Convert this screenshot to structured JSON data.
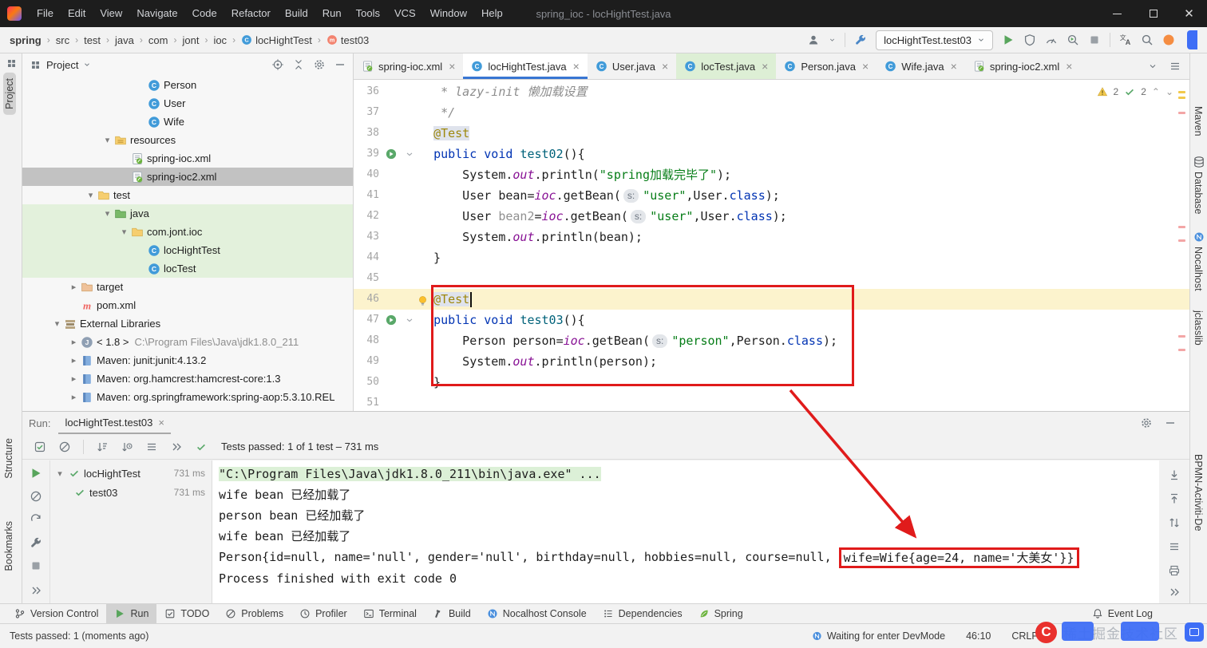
{
  "colors": {
    "accent_blue": "#3876d3",
    "annotation_red": "#e01b1b",
    "test_green": "#59a869",
    "selection_gray": "#c2c2c2",
    "test_row_green": "#e3f1dc",
    "current_line": "#fcf3cd"
  },
  "titlebar": {
    "menus": [
      "File",
      "Edit",
      "View",
      "Navigate",
      "Code",
      "Refactor",
      "Build",
      "Run",
      "Tools",
      "VCS",
      "Window",
      "Help"
    ],
    "title": "spring_ioc - locHightTest.java"
  },
  "navbar": {
    "crumbs": [
      {
        "label": "spring"
      },
      {
        "label": "src"
      },
      {
        "label": "test"
      },
      {
        "label": "java"
      },
      {
        "label": "com"
      },
      {
        "label": "jont"
      },
      {
        "label": "ioc"
      },
      {
        "label": "locHightTest",
        "icon": "cls"
      },
      {
        "label": "test03",
        "icon": "method"
      }
    ],
    "run_config": "locHightTest.test03"
  },
  "left_strip": {
    "items": [
      "Project",
      "Structure",
      "Bookmarks"
    ]
  },
  "right_strip": {
    "top": [
      "Maven",
      "Database",
      "Nocalhost",
      "jclasslib"
    ],
    "bottom": [
      "BPMN-Activiti-De"
    ]
  },
  "project": {
    "title": "Project",
    "rows": [
      {
        "label": "Person",
        "icon": "cls",
        "indent": 6
      },
      {
        "label": "User",
        "icon": "cls",
        "indent": 6
      },
      {
        "label": "Wife",
        "icon": "cls",
        "indent": 6
      },
      {
        "label": "resources",
        "icon": "folderres",
        "indent": 4,
        "chev": "v"
      },
      {
        "label": "spring-ioc.xml",
        "icon": "springxml",
        "indent": 5
      },
      {
        "label": "spring-ioc2.xml",
        "icon": "springxml",
        "indent": 5,
        "selected": true
      },
      {
        "label": "test",
        "icon": "folder",
        "indent": 3,
        "chev": "v"
      },
      {
        "label": "java",
        "icon": "foldertest",
        "indent": 4,
        "chev": "v",
        "green": true
      },
      {
        "label": "com.jont.ioc",
        "icon": "folder",
        "indent": 5,
        "chev": "v",
        "green": true
      },
      {
        "label": "locHightTest",
        "icon": "cls",
        "indent": 6,
        "green": true
      },
      {
        "label": "locTest",
        "icon": "cls",
        "indent": 6,
        "green": true
      },
      {
        "label": "target",
        "icon": "folderexcl",
        "indent": 2,
        "chev": ">"
      },
      {
        "label": "pom.xml",
        "icon": "maven",
        "indent": 2
      },
      {
        "label": "External Libraries",
        "icon": "libs",
        "indent": 1,
        "chev": "v"
      },
      {
        "label": "< 1.8 >",
        "sub": "C:\\Program Files\\Java\\jdk1.8.0_211",
        "icon": "jdk",
        "indent": 2,
        "chev": ">"
      },
      {
        "label": "Maven: junit:junit:4.13.2",
        "icon": "lib",
        "indent": 2,
        "chev": ">"
      },
      {
        "label": "Maven: org.hamcrest:hamcrest-core:1.3",
        "icon": "lib",
        "indent": 2,
        "chev": ">"
      },
      {
        "label": "Maven: org.springframework:spring-aop:5.3.10.REL",
        "icon": "lib",
        "indent": 2,
        "chev": ">"
      }
    ]
  },
  "editor_tabs": {
    "tabs": [
      {
        "label": "spring-ioc.xml",
        "icon": "springxml"
      },
      {
        "label": "locHightTest.java",
        "icon": "cls",
        "active": true
      },
      {
        "label": "User.java",
        "icon": "cls"
      },
      {
        "label": "locTest.java",
        "icon": "cls",
        "green": true
      },
      {
        "label": "Person.java",
        "icon": "cls"
      },
      {
        "label": "Wife.java",
        "icon": "cls"
      },
      {
        "label": "spring-ioc2.xml",
        "icon": "springxml"
      }
    ]
  },
  "inspections": {
    "warnings": "2",
    "checks": "2"
  },
  "editor": {
    "lines": [
      {
        "n": "36",
        "segs": [
          [
            "cmt",
            "   * lazy-init 懒加载设置"
          ]
        ]
      },
      {
        "n": "37",
        "segs": [
          [
            "cmt",
            "   */"
          ]
        ]
      },
      {
        "n": "38",
        "segs": [
          [
            "pln",
            "  "
          ],
          [
            "annhl",
            "@Test"
          ]
        ]
      },
      {
        "n": "39",
        "run": true,
        "fold": true,
        "segs": [
          [
            "pln",
            "  "
          ],
          [
            "kw",
            "public"
          ],
          [
            "pln",
            " "
          ],
          [
            "kw",
            "void"
          ],
          [
            "pln",
            " "
          ],
          [
            "mth",
            "test02"
          ],
          [
            "pln",
            "(){"
          ]
        ]
      },
      {
        "n": "40",
        "segs": [
          [
            "pln",
            "      System."
          ],
          [
            "fld",
            "out"
          ],
          [
            "pln",
            ".println("
          ],
          [
            "str",
            "\"spring加载完毕了\""
          ],
          [
            "pln",
            ");"
          ]
        ]
      },
      {
        "n": "41",
        "segs": [
          [
            "pln",
            "      User bean="
          ],
          [
            "fld",
            "ioc"
          ],
          [
            "pln",
            ".getBean("
          ],
          [
            "hint",
            "s:"
          ],
          [
            "str",
            "\"user\""
          ],
          [
            "pln",
            ",User."
          ],
          [
            "kw",
            "class"
          ],
          [
            "pln",
            ");"
          ]
        ]
      },
      {
        "n": "42",
        "segs": [
          [
            "pln",
            "      User "
          ],
          [
            "gray",
            "bean2"
          ],
          [
            "pln",
            "="
          ],
          [
            "fld",
            "ioc"
          ],
          [
            "pln",
            ".getBean("
          ],
          [
            "hint",
            "s:"
          ],
          [
            "str",
            "\"user\""
          ],
          [
            "pln",
            ",User."
          ],
          [
            "kw",
            "class"
          ],
          [
            "pln",
            ");"
          ]
        ]
      },
      {
        "n": "43",
        "segs": [
          [
            "pln",
            "      System."
          ],
          [
            "fld",
            "out"
          ],
          [
            "pln",
            ".println(bean);"
          ]
        ]
      },
      {
        "n": "44",
        "segs": [
          [
            "pln",
            "  }"
          ]
        ]
      },
      {
        "n": "45",
        "segs": []
      },
      {
        "n": "46",
        "cur": true,
        "bulb": true,
        "segs": [
          [
            "pln",
            "  "
          ],
          [
            "annhl",
            "@Test"
          ],
          [
            "caret",
            ""
          ]
        ]
      },
      {
        "n": "47",
        "run": true,
        "fold": true,
        "segs": [
          [
            "pln",
            "  "
          ],
          [
            "kw",
            "public"
          ],
          [
            "pln",
            " "
          ],
          [
            "kw",
            "void"
          ],
          [
            "pln",
            " "
          ],
          [
            "mth",
            "test03"
          ],
          [
            "pln",
            "(){"
          ]
        ]
      },
      {
        "n": "48",
        "segs": [
          [
            "pln",
            "      Person person="
          ],
          [
            "fld",
            "ioc"
          ],
          [
            "pln",
            ".getBean("
          ],
          [
            "hint",
            "s:"
          ],
          [
            "str",
            "\"person\""
          ],
          [
            "pln",
            ",Person."
          ],
          [
            "kw",
            "class"
          ],
          [
            "pln",
            ");"
          ]
        ]
      },
      {
        "n": "49",
        "segs": [
          [
            "pln",
            "      System."
          ],
          [
            "fld",
            "out"
          ],
          [
            "pln",
            ".println(person);"
          ]
        ]
      },
      {
        "n": "50",
        "segs": [
          [
            "pln",
            "  }"
          ]
        ]
      },
      {
        "n": "51",
        "segs": []
      }
    ]
  },
  "run": {
    "label": "Run:",
    "tab": "locHightTest.test03",
    "status": "Tests passed: 1 of 1 test – 731 ms",
    "tree": [
      {
        "name": "locHightTest",
        "time": "731 ms",
        "parent": true
      },
      {
        "name": "test03",
        "time": "731 ms"
      }
    ],
    "console": [
      {
        "text": "\"C:\\Program Files\\Java\\jdk1.8.0_211\\bin\\java.exe\" ...",
        "hl": true
      },
      {
        "text": "wife bean 已经加载了"
      },
      {
        "text": "person bean 已经加载了"
      },
      {
        "text": "wife bean 已经加载了"
      },
      {
        "pre": "Person{id=null, name='null', gender='null', birthday=null, hobbies=null, course=null, ",
        "boxed": "wife=Wife{age=24, name='大美女'}}"
      },
      {
        "text": ""
      },
      {
        "text": "Process finished with exit code 0"
      }
    ]
  },
  "bottom_bar": {
    "items": [
      {
        "label": "Version Control",
        "icon": "branch"
      },
      {
        "label": "Run",
        "icon": "play",
        "active": true
      },
      {
        "label": "TODO",
        "icon": "todo"
      },
      {
        "label": "Problems",
        "icon": "problems"
      },
      {
        "label": "Profiler",
        "icon": "clock"
      },
      {
        "label": "Terminal",
        "icon": "terminal"
      },
      {
        "label": "Build",
        "icon": "hammer"
      },
      {
        "label": "Nocalhost Console",
        "icon": "nocal"
      },
      {
        "label": "Dependencies",
        "icon": "deps"
      },
      {
        "label": "Spring",
        "icon": "leaf"
      }
    ],
    "right": {
      "label": "Event Log",
      "icon": "bell"
    }
  },
  "status_bar": {
    "tests": "Tests passed: 1 (moments ago)",
    "devmode": "Waiting for enter DevMode",
    "caret_pos": "46:10",
    "line_sep": "CRLF"
  },
  "watermark": {
    "text": "稀土掘金技术社区"
  }
}
